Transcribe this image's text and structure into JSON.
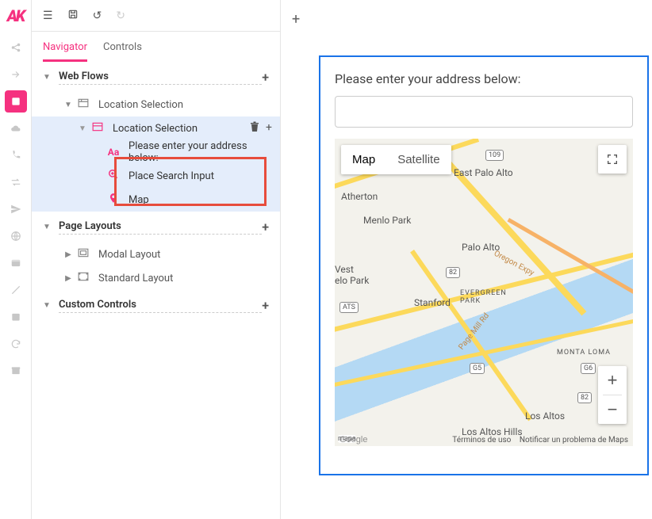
{
  "brand": "AK",
  "tabs": {
    "navigator": "Navigator",
    "controls": "Controls"
  },
  "sections": {
    "webflows": "Web Flows",
    "pagelayouts": "Page Layouts",
    "customcontrols": "Custom Controls"
  },
  "tree": {
    "loc_sel_flow": "Location Selection",
    "loc_sel_page": "Location Selection",
    "addr_label": "Please enter your address below:",
    "place_search": "Place Search Input",
    "map": "Map",
    "modal_layout": "Modal Layout",
    "standard_layout": "Standard Layout"
  },
  "preview": {
    "prompt": "Please enter your address below:",
    "map_tab": "Map",
    "sat_tab": "Satellite",
    "places": {
      "east_palo_alto": "East Palo Alto",
      "atherton": "Atherton",
      "menlo_park": "Menlo Park",
      "palo_alto": "Palo Alto",
      "west_elo_park": "Vest\nelo Park",
      "stanford": "Stanford",
      "evergreen_park": "EVERGREEN\nPARK",
      "monta_loma": "MONTA LOMA",
      "los_altos": "Los Altos",
      "los_altos_hills": "Los Altos Hills",
      "oregon_expy": "Oregon Expy",
      "page_mill_rd": "Page Mill Rd"
    },
    "shields": {
      "r109": "109",
      "r82": "82",
      "r82b": "82",
      "gs": "G5",
      "g6": "G6",
      "ats": "ATS",
      "mapa": "mapa"
    },
    "google": "Google",
    "legal_terms": "Términos de uso",
    "legal_report": "Notificar un problema de Maps"
  }
}
